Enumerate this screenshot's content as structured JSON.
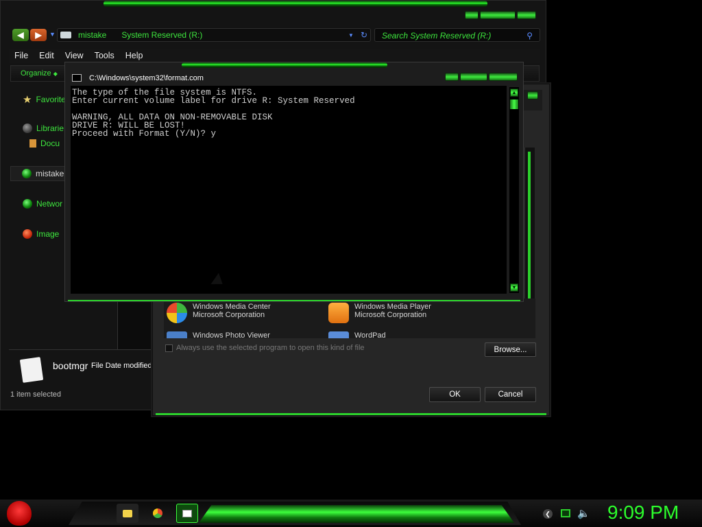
{
  "explorer": {
    "address": {
      "current_folder": "mistake",
      "drive": "System Reserved (R:)"
    },
    "search": {
      "placeholder": "Search System Reserved (R:)"
    },
    "menu": [
      "File",
      "Edit",
      "View",
      "Tools",
      "Help"
    ],
    "toolbar": {
      "organize": "Organize"
    },
    "nav": {
      "favorites": "Favorite",
      "libraries": "Librarie",
      "documents": "Docu",
      "homegroup": "mistake",
      "network": "Networ",
      "image": "Image"
    },
    "details": {
      "file_name": "bootmgr",
      "meta_label": "File Date modified:"
    },
    "status": "1 item selected"
  },
  "openwith": {
    "apps": [
      {
        "name": "Windows Media Center",
        "publisher": "Microsoft Corporation"
      },
      {
        "name": "Windows Media Player",
        "publisher": "Microsoft Corporation"
      },
      {
        "name": "Windows Photo Viewer",
        "publisher": ""
      },
      {
        "name": "WordPad",
        "publisher": ""
      }
    ],
    "always_use": "Always use the selected program to open this kind of file",
    "browse": "Browse...",
    "ok": "OK",
    "cancel": "Cancel"
  },
  "console": {
    "title": "C:\\Windows\\system32\\format.com",
    "lines": [
      "The type of the file system is NTFS.",
      "Enter current volume label for drive R: System Reserved",
      "",
      "WARNING, ALL DATA ON NON-REMOVABLE DISK",
      "DRIVE R: WILL BE LOST!",
      "Proceed with Format (Y/N)? y"
    ]
  },
  "taskbar": {
    "clock": "9:09 PM"
  },
  "colors": {
    "accent": "#2cff2c",
    "window_bg": "#141414",
    "console_bg": "#000000"
  },
  "icons": [
    "angry-bird-start-icon",
    "folder-icon",
    "chrome-icon",
    "console-icon",
    "arrow-icon",
    "monitor-icon",
    "speaker-icon"
  ]
}
